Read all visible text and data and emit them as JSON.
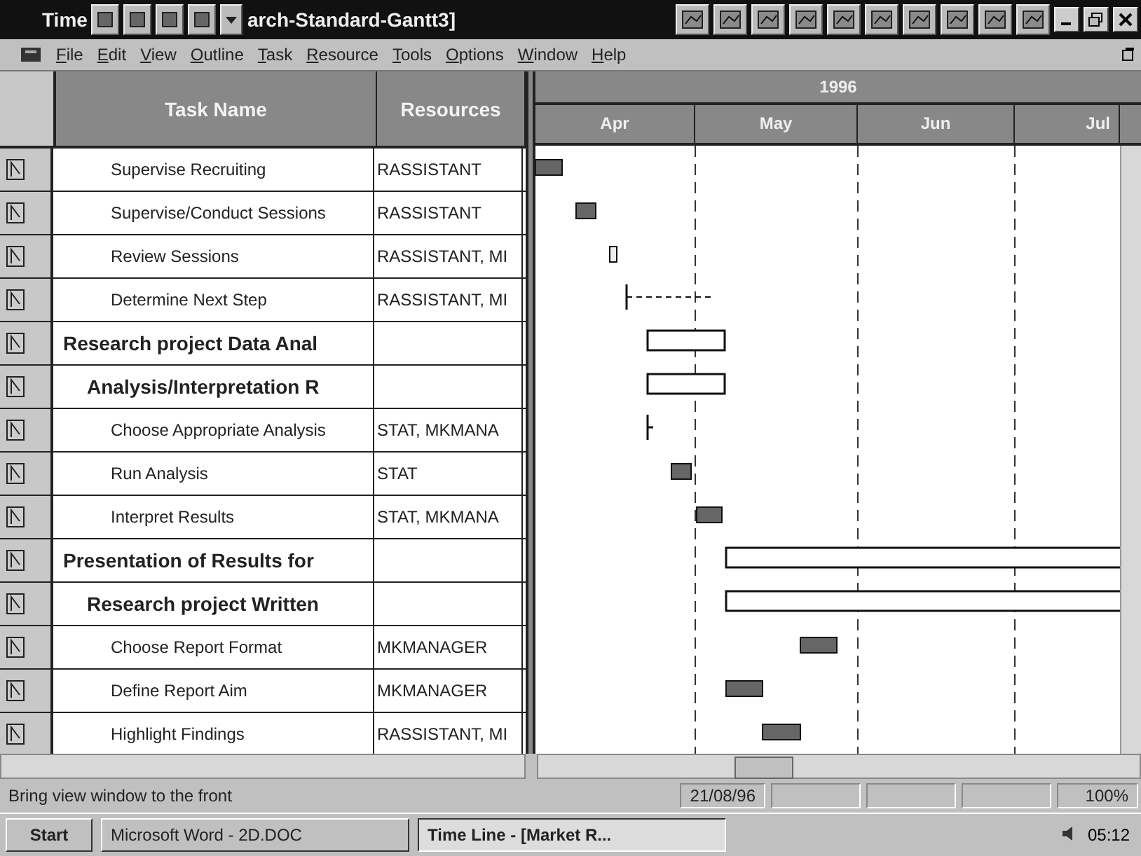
{
  "window": {
    "title_left": "Time",
    "title_right": "arch-Standard-Gantt3]"
  },
  "menu": [
    "File",
    "Edit",
    "View",
    "Outline",
    "Task",
    "Resource",
    "Tools",
    "Options",
    "Window",
    "Help"
  ],
  "table": {
    "columns": [
      "Task Name",
      "Resources"
    ],
    "rows": [
      {
        "kind": "task",
        "name": "Supervise Recruiting",
        "resources": "RASSISTANT"
      },
      {
        "kind": "task",
        "name": "Supervise/Conduct Sessions",
        "resources": "RASSISTANT"
      },
      {
        "kind": "task",
        "name": "Review Sessions",
        "resources": "RASSISTANT, MI"
      },
      {
        "kind": "task",
        "name": "Determine Next Step",
        "resources": "RASSISTANT, MI"
      },
      {
        "kind": "phase",
        "name": "Research project Data Anal"
      },
      {
        "kind": "group",
        "name": "Analysis/Interpretation R"
      },
      {
        "kind": "task",
        "name": "Choose Appropriate Analysis",
        "resources": "STAT, MKMANA"
      },
      {
        "kind": "task",
        "name": "Run Analysis",
        "resources": "STAT"
      },
      {
        "kind": "task",
        "name": "Interpret Results",
        "resources": "STAT, MKMANA"
      },
      {
        "kind": "phase",
        "name": "Presentation of Results for"
      },
      {
        "kind": "group",
        "name": "Research project Written"
      },
      {
        "kind": "task",
        "name": "Choose Report Format",
        "resources": "MKMANAGER"
      },
      {
        "kind": "task",
        "name": "Define Report Aim",
        "resources": "MKMANAGER"
      },
      {
        "kind": "task",
        "name": "Highlight Findings",
        "resources": "RASSISTANT, MI"
      }
    ]
  },
  "timescale": {
    "year": "1996",
    "months": [
      "Apr",
      "May",
      "Jun",
      "Jul"
    ]
  },
  "status_bar": {
    "message": "Bring view window to the front",
    "date": "21/08/96",
    "zoom": "100%"
  },
  "taskbar": {
    "start": "Start",
    "tasks": [
      {
        "label": "Microsoft Word - 2D.DOC",
        "selected": false
      },
      {
        "label": "Time Line - [Market R...",
        "selected": true
      }
    ],
    "clock": "05:12"
  }
}
